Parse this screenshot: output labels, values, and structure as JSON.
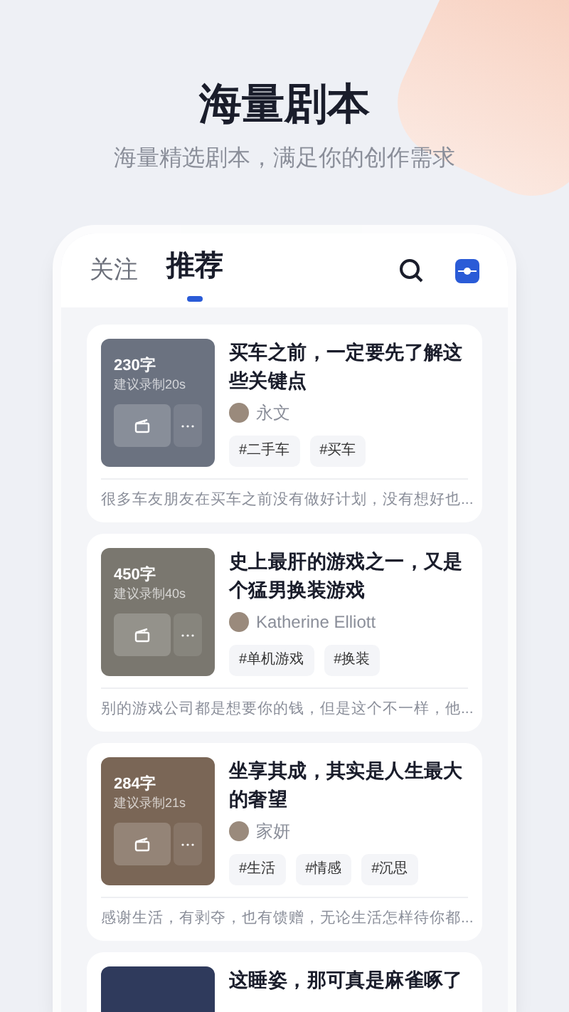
{
  "header": {
    "title": "海量剧本",
    "subtitle": "海量精选剧本，满足你的创作需求"
  },
  "tabs": [
    {
      "label": "关注",
      "selected": false
    },
    {
      "label": "推荐",
      "selected": true
    }
  ],
  "cards": [
    {
      "word_count": "230字",
      "suggestion": "建议录制20s",
      "title": "买车之前，一定要先了解这些关键点",
      "author": "永文",
      "tags": [
        "#二手车",
        "#买车"
      ],
      "excerpt": "很多车友朋友在买车之前没有做好计划，没有想好也..."
    },
    {
      "word_count": "450字",
      "suggestion": "建议录制40s",
      "title": "史上最肝的游戏之一，又是个猛男换装游戏",
      "author": "Katherine Elliott",
      "tags": [
        "#单机游戏",
        "#换装"
      ],
      "excerpt": "别的游戏公司都是想要你的钱，但是这个不一样，他..."
    },
    {
      "word_count": "284字",
      "suggestion": "建议录制21s",
      "title": "坐享其成，其实是人生最大的奢望",
      "author": "家妍",
      "tags": [
        "#生活",
        "#情感",
        "#沉思"
      ],
      "excerpt": "感谢生活，有剥夺，也有馈赠，无论生活怎样待你都..."
    },
    {
      "title": "这睡姿，那可真是麻雀啄了"
    }
  ]
}
